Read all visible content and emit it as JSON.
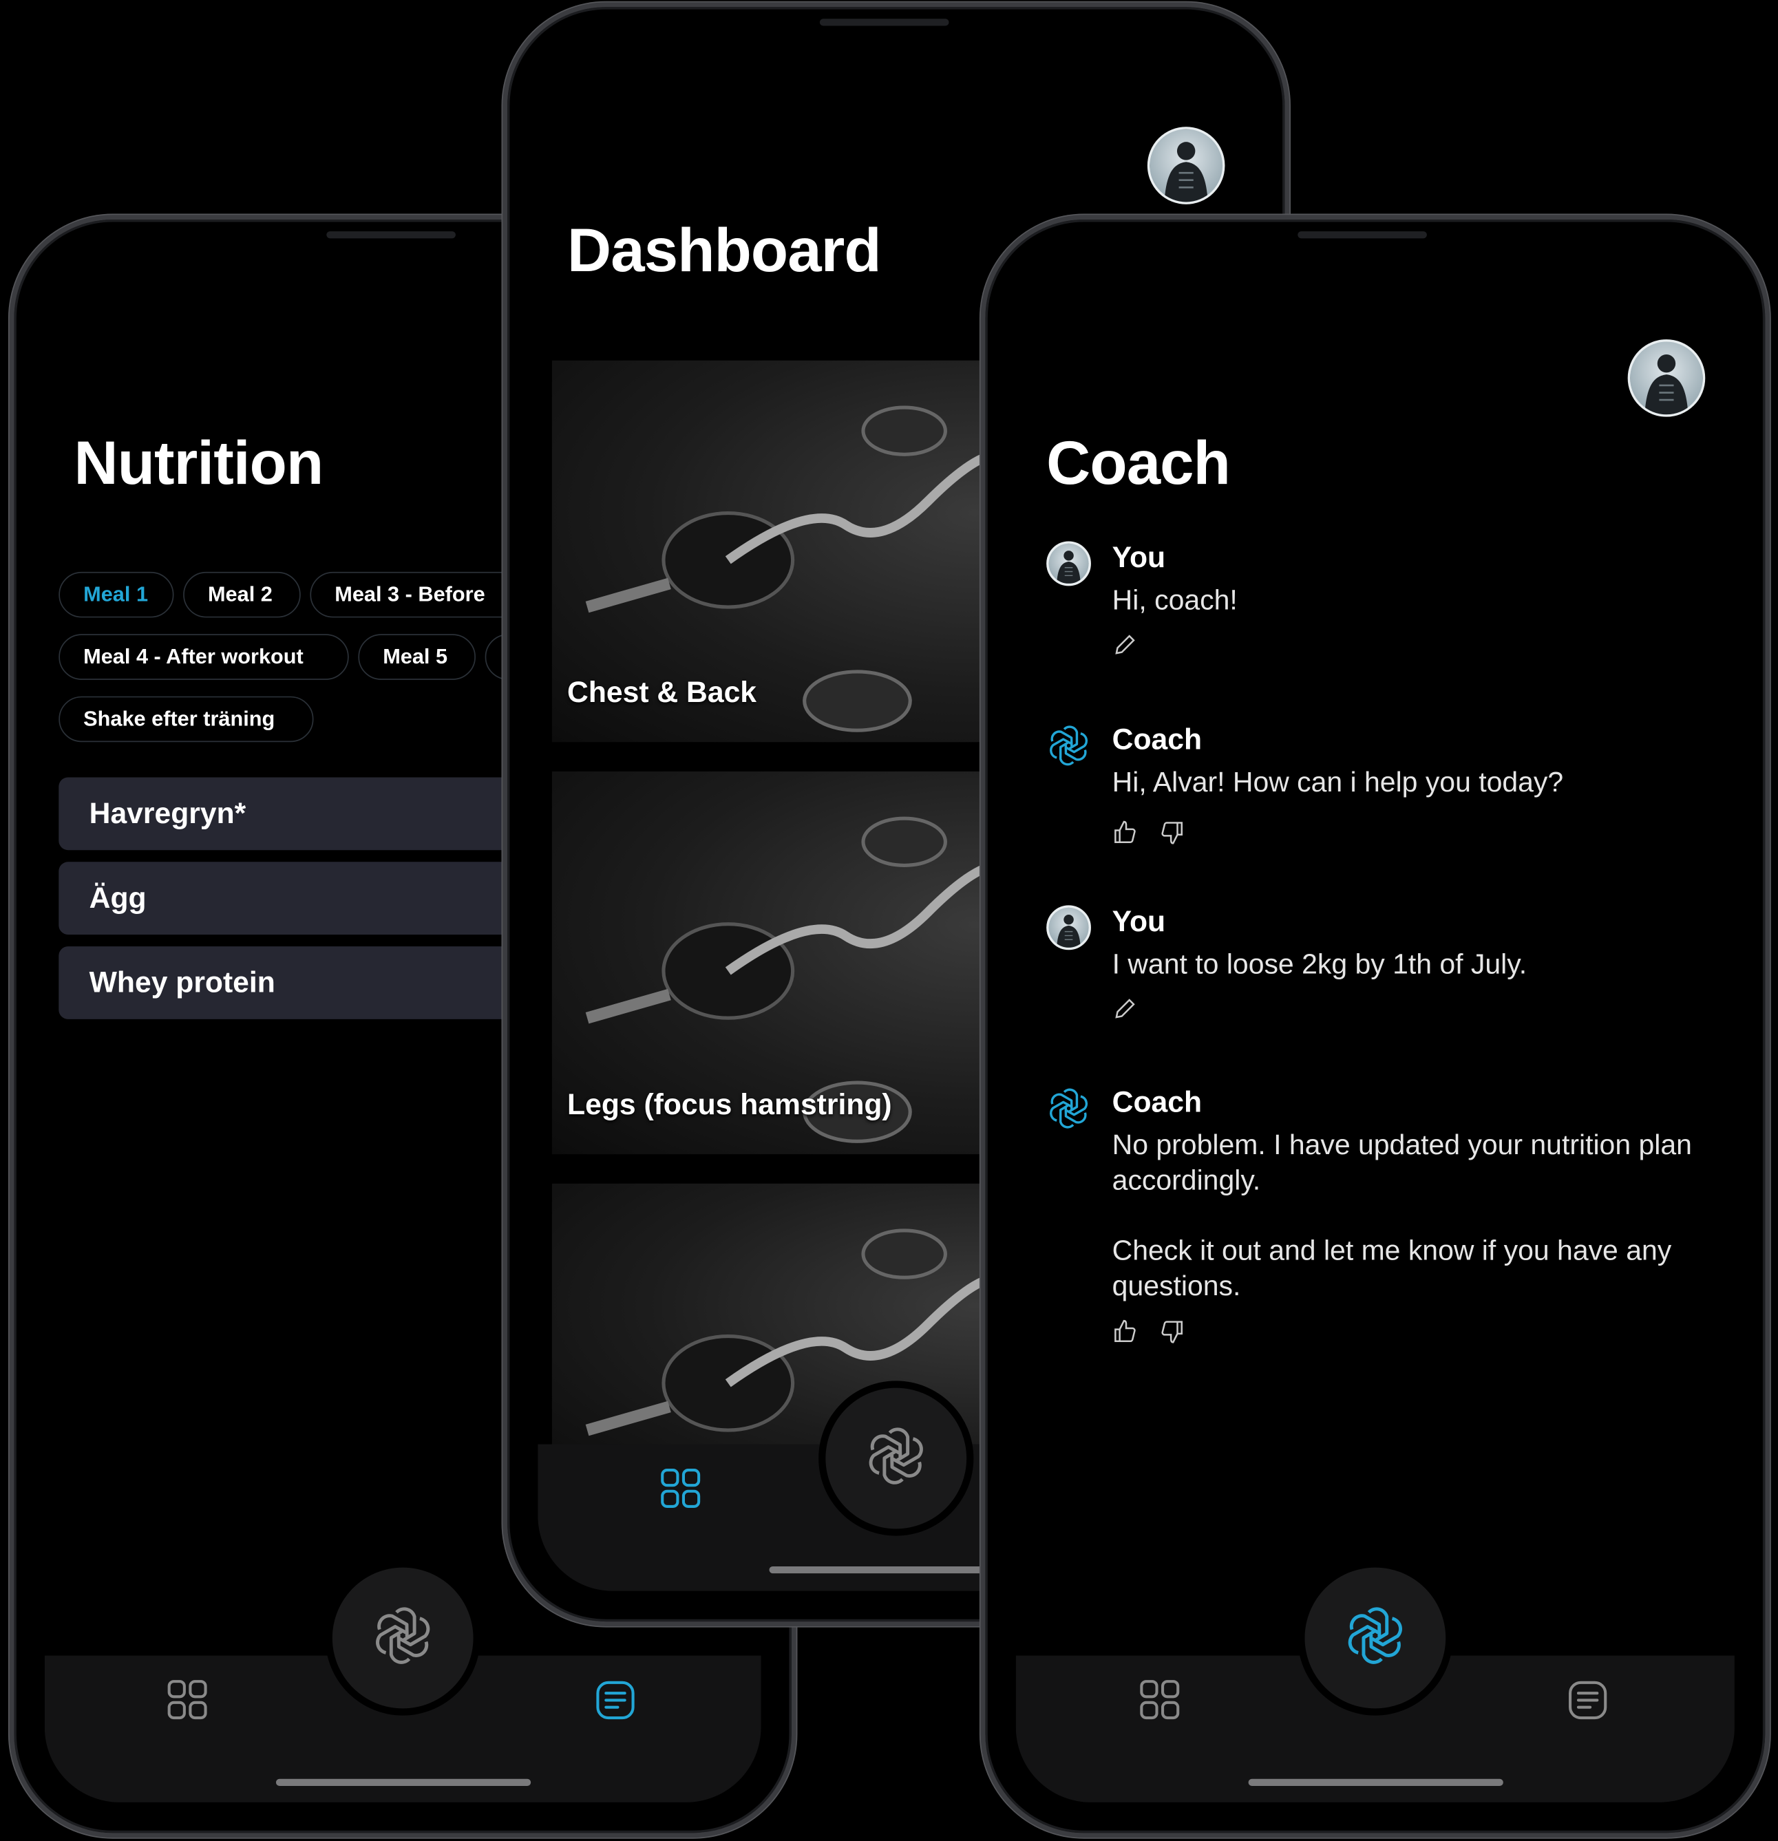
{
  "accent": "#22a6d6",
  "nutrition": {
    "title": "Nutrition",
    "meals": [
      {
        "label": "Meal 1",
        "active": true
      },
      {
        "label": "Meal 2",
        "active": false
      },
      {
        "label": "Meal 3 - Before",
        "active": false
      },
      {
        "label": "Meal 4 - After workout",
        "active": false
      },
      {
        "label": "Meal 5",
        "active": false
      },
      {
        "label": "",
        "active": false
      },
      {
        "label": "Shake efter träning",
        "active": false
      }
    ],
    "foods": [
      "Havregryn*",
      "Ägg",
      "Whey protein"
    ],
    "nav": {
      "left_icon": "grid-icon",
      "center_icon": "openai-logo-icon",
      "right_icon": "list-icon",
      "active": "right"
    }
  },
  "dashboard": {
    "title": "Dashboard",
    "workouts": [
      "Chest & Back",
      "Legs (focus hamstring)",
      ""
    ],
    "nav": {
      "left_icon": "grid-icon",
      "center_icon": "openai-logo-icon",
      "active": "left"
    }
  },
  "coach": {
    "title": "Coach",
    "messages": [
      {
        "sender": "You",
        "text": "Hi, coach!",
        "actions": [
          "edit-icon"
        ]
      },
      {
        "sender": "Coach",
        "text": "Hi, Alvar! How can i help you today?",
        "actions": [
          "thumbs-up-icon",
          "thumbs-down-icon"
        ]
      },
      {
        "sender": "You",
        "text": "I want to loose 2kg by 1th of July.",
        "actions": [
          "edit-icon"
        ]
      },
      {
        "sender": "Coach",
        "text": "No problem. I have updated your nutrition plan accordingly.",
        "text2": "Check it out and let me know if you have any questions.",
        "actions": [
          "thumbs-up-icon",
          "thumbs-down-icon"
        ]
      }
    ],
    "nav": {
      "left_icon": "grid-icon",
      "center_icon": "openai-logo-icon",
      "right_icon": "list-icon",
      "active": "center"
    }
  }
}
